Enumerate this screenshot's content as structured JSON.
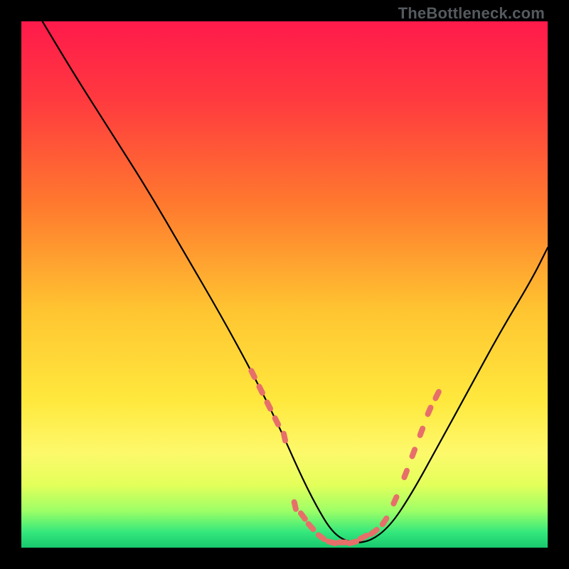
{
  "watermark": "TheBottleneck.com",
  "colors": {
    "frame_bg": "#000000",
    "gradient_stops": [
      {
        "offset": 0.0,
        "color": "#ff1a4b"
      },
      {
        "offset": 0.15,
        "color": "#ff3a3f"
      },
      {
        "offset": 0.35,
        "color": "#ff7a2e"
      },
      {
        "offset": 0.55,
        "color": "#ffc531"
      },
      {
        "offset": 0.72,
        "color": "#ffe83d"
      },
      {
        "offset": 0.82,
        "color": "#fdf96b"
      },
      {
        "offset": 0.88,
        "color": "#e4ff5a"
      },
      {
        "offset": 0.93,
        "color": "#9dff66"
      },
      {
        "offset": 0.97,
        "color": "#35e87c"
      },
      {
        "offset": 1.0,
        "color": "#17c96e"
      }
    ],
    "curve_stroke": "#000000",
    "marker_color": "#e76f6a"
  },
  "chart_data": {
    "type": "line",
    "title": "",
    "xlabel": "",
    "ylabel": "",
    "xlim": [
      0,
      100
    ],
    "ylim": [
      0,
      100
    ],
    "series": [
      {
        "name": "bottleneck-curve",
        "x": [
          4,
          10,
          17,
          24,
          31,
          38,
          44,
          49,
          53,
          56,
          59,
          62,
          66,
          70,
          74,
          79,
          85,
          91,
          97,
          100
        ],
        "y": [
          100,
          90,
          79,
          68,
          56,
          44,
          33,
          23,
          14,
          8,
          3,
          1,
          1,
          4,
          10,
          19,
          30,
          41,
          51,
          57
        ]
      }
    ],
    "markers": {
      "name": "highlighted-segments",
      "points": [
        {
          "x": 44,
          "y": 33
        },
        {
          "x": 45.5,
          "y": 30
        },
        {
          "x": 47,
          "y": 27
        },
        {
          "x": 48.5,
          "y": 24
        },
        {
          "x": 50,
          "y": 21
        },
        {
          "x": 52,
          "y": 8
        },
        {
          "x": 53.5,
          "y": 6
        },
        {
          "x": 55,
          "y": 4
        },
        {
          "x": 57,
          "y": 2
        },
        {
          "x": 59,
          "y": 1
        },
        {
          "x": 61,
          "y": 1
        },
        {
          "x": 63,
          "y": 1
        },
        {
          "x": 65,
          "y": 2
        },
        {
          "x": 67,
          "y": 3
        },
        {
          "x": 69,
          "y": 5
        },
        {
          "x": 71,
          "y": 9
        },
        {
          "x": 73,
          "y": 14
        },
        {
          "x": 74.5,
          "y": 18
        },
        {
          "x": 76,
          "y": 22
        },
        {
          "x": 77.5,
          "y": 26
        },
        {
          "x": 79,
          "y": 29
        }
      ]
    }
  }
}
